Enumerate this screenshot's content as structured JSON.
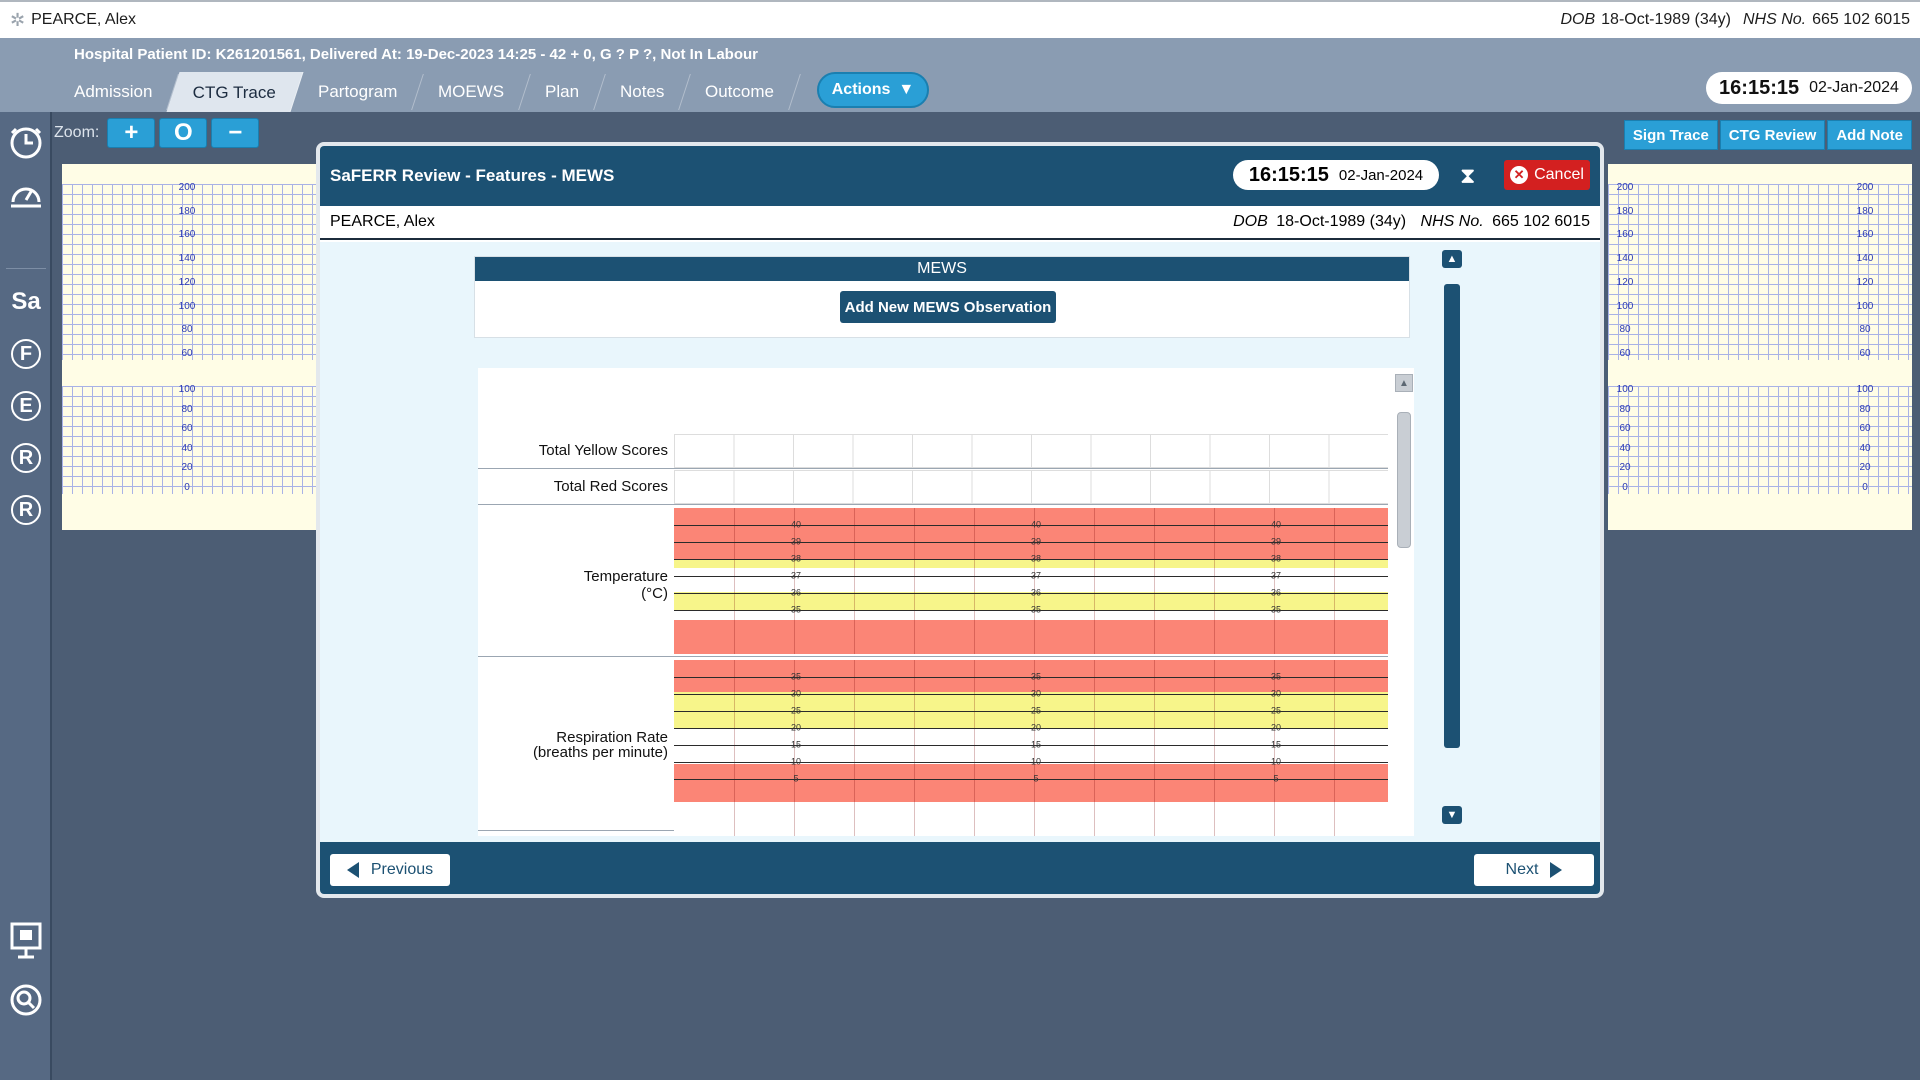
{
  "patient_bar": {
    "name": "PEARCE, Alex",
    "dob_label": "DOB",
    "dob_value": "18-Oct-1989 (34y)",
    "nhs_label": "NHS No.",
    "nhs_value": "665 102 6015"
  },
  "header": {
    "patient_info": "Hospital Patient ID: K261201561, Delivered At: 19-Dec-2023 14:25 - 42 + 0, G ? P ?,   Not In Labour",
    "tabs": [
      "Admission",
      "CTG Trace",
      "Partogram",
      "MOEWS",
      "Plan",
      "Notes",
      "Outcome"
    ],
    "active_tab": "CTG Trace",
    "actions_label": "Actions",
    "clock_time": "16:15:15",
    "clock_date": "02-Jan-2024"
  },
  "sidebar": {
    "letters": [
      "Sa",
      "F",
      "E",
      "R",
      "R"
    ]
  },
  "toolbar": {
    "zoom_label": "Zoom:",
    "zoom_in": "+",
    "zoom_reset": "O",
    "zoom_out": "−",
    "sign_trace": "Sign Trace",
    "ctg_review": "CTG Review",
    "add_note": "Add Note"
  },
  "trace_axis": {
    "fhr": [
      "200",
      "180",
      "160",
      "140",
      "120",
      "100",
      "80",
      "60"
    ],
    "toco": [
      "100",
      "80",
      "60",
      "40",
      "20",
      "0"
    ]
  },
  "modal": {
    "title": "SaFERR Review - Features - MEWS",
    "clock_time": "16:15:15",
    "clock_date": "02-Jan-2024",
    "cancel_label": "Cancel",
    "patient_name": "PEARCE, Alex",
    "dob_label": "DOB",
    "dob_value": "18-Oct-1989 (34y)",
    "nhs_label": "NHS No.",
    "nhs_value": "665 102 6015",
    "mews_header": "MEWS",
    "add_mews_label": "Add New MEWS Observation",
    "rows": {
      "yellow": "Total Yellow Scores",
      "red": "Total Red Scores",
      "temperature_l1": "Temperature",
      "temperature_l2": "(°C)",
      "resp_l1": "Respiration Rate",
      "resp_l2": "(breaths per minute)"
    },
    "temperature_ticks": [
      "40",
      "39",
      "38",
      "37",
      "36",
      "35"
    ],
    "resp_ticks": [
      "35",
      "30",
      "25",
      "20",
      "15",
      "10",
      "5"
    ],
    "previous_label": "Previous",
    "next_label": "Next"
  },
  "colors": {
    "red_band": "#fb8576",
    "yellow_band": "#f7f58a",
    "modal_header": "#1c5173",
    "accent": "#2a9fd6"
  }
}
